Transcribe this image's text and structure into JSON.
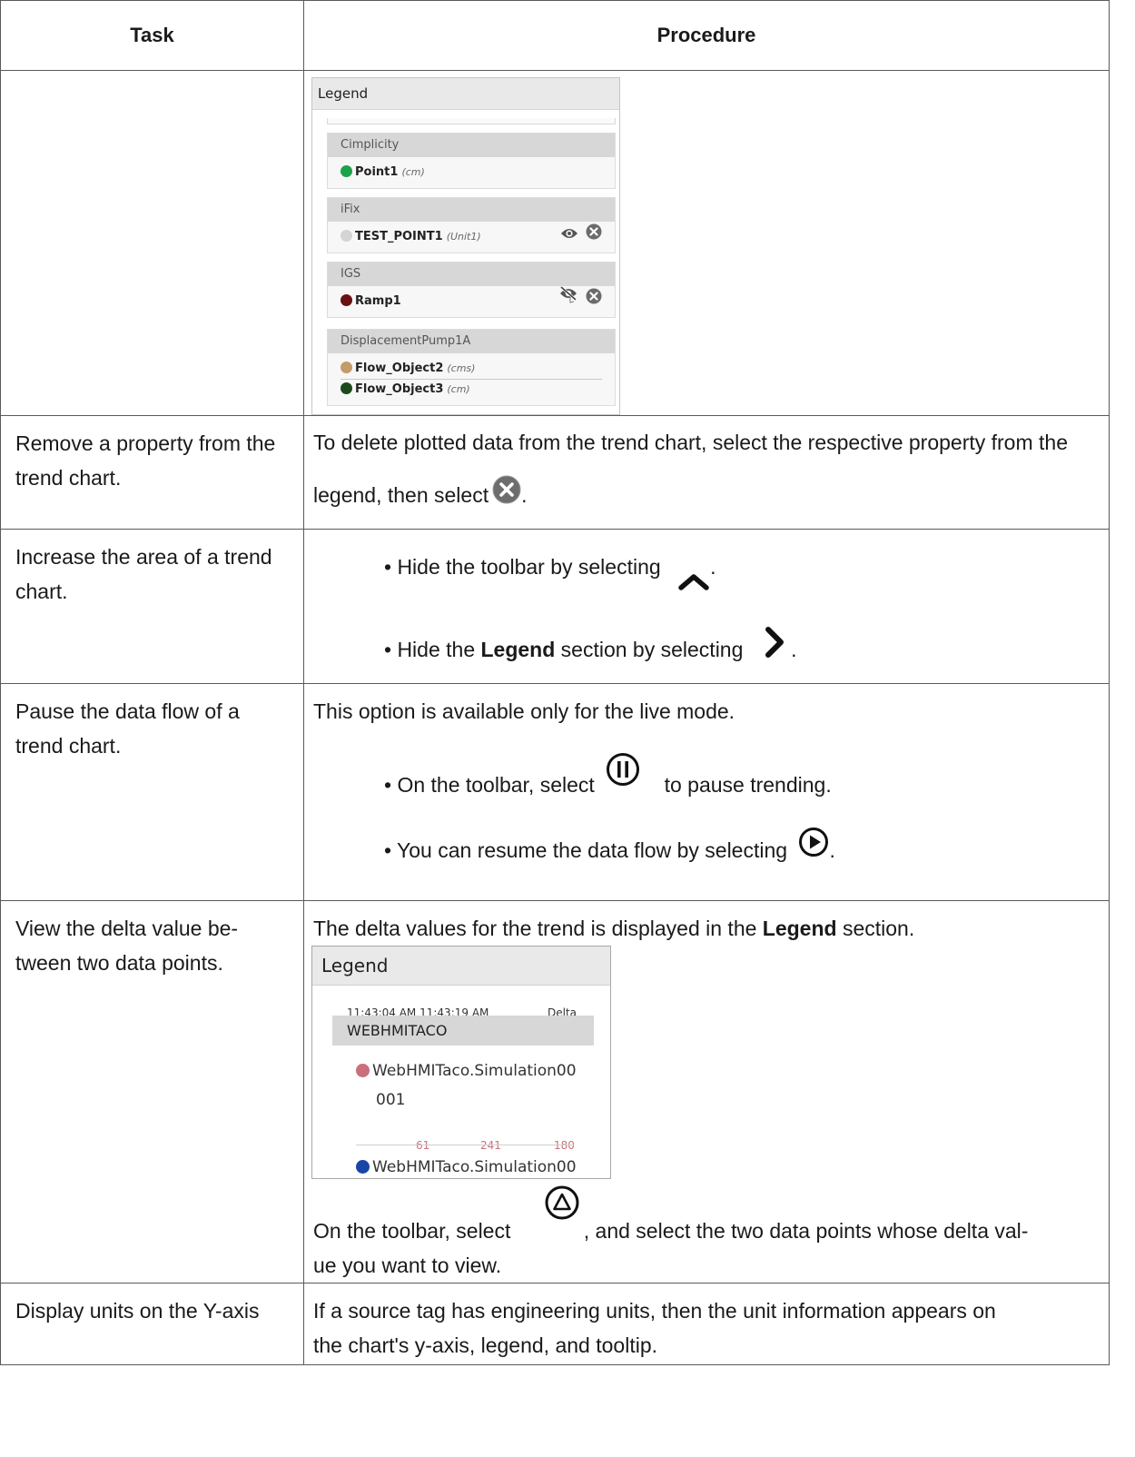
{
  "table": {
    "header_task": "Task",
    "header_procedure": "Procedure"
  },
  "legend1": {
    "title": "Legend",
    "groups": [
      {
        "name": "Cimplicity",
        "items": [
          {
            "name": "Point1",
            "unit": "(cm)",
            "color": "#1aa34a"
          }
        ]
      },
      {
        "name": "iFix",
        "items": [
          {
            "name": "TEST_POINT1",
            "unit": "(Unit1)",
            "color": "#d4d4d4"
          }
        ]
      },
      {
        "name": "IGS",
        "items": [
          {
            "name": "Ramp1",
            "unit": "",
            "color": "#6b1010"
          }
        ]
      },
      {
        "name": "DisplacementPump1A",
        "items": [
          {
            "name": "Flow_Object2",
            "unit": "(cms)",
            "color": "#c69a6b"
          },
          {
            "name": "Flow_Object3",
            "unit": "(cm)",
            "color": "#1c4a1c"
          }
        ]
      }
    ]
  },
  "rows": {
    "remove": {
      "task": "Remove a property from the trend chart.",
      "proc_text": "To delete plotted data from the trend chart, select the respective property from the legend, then select"
    },
    "increase": {
      "task": "Increase the area of a trend chart.",
      "bullet1": "• Hide the toolbar by selecting",
      "bullet2_pre": "• Hide the",
      "bullet2_bold": "Legend",
      "bullet2_post": "section by selecting"
    },
    "pause": {
      "task": "Pause the data flow of a trend chart.",
      "intro": "This option is available only for the live mode.",
      "bullet1_pre": "• On the toolbar, select",
      "bullet1_post": "to pause trending.",
      "bullet2": "• You can resume the data flow by selecting"
    },
    "delta": {
      "task_line1": "View the delta value be-",
      "task_line2": "tween two data points.",
      "intro_pre": "The delta values for the trend is displayed in the",
      "intro_bold": "Legend",
      "intro_post": "section.",
      "legend_title": "Legend",
      "time_from": "11:43:04 AM",
      "time_to": "11:43:19 AM",
      "delta_label": "Delta",
      "group": "WEBHMITACO",
      "item1_line1": "WebHMITaco.Simulation00",
      "item1_line2": "001",
      "item1_color": "#c9707a",
      "val1": "61",
      "val2": "241",
      "val3": "180",
      "item2_line1": "WebHMITaco.Simulation00",
      "item2_color": "#1a44a8",
      "outro_pre": "On the toolbar, select",
      "outro_post_line1": ", and select the two data points whose delta val-",
      "outro_line2": "ue you want to view."
    },
    "units": {
      "task": "Display units on the Y-axis",
      "proc_line1": "If a source tag has engineering units, then the unit information appears on",
      "proc_line2": "the chart's y-axis, legend, and tooltip."
    }
  }
}
